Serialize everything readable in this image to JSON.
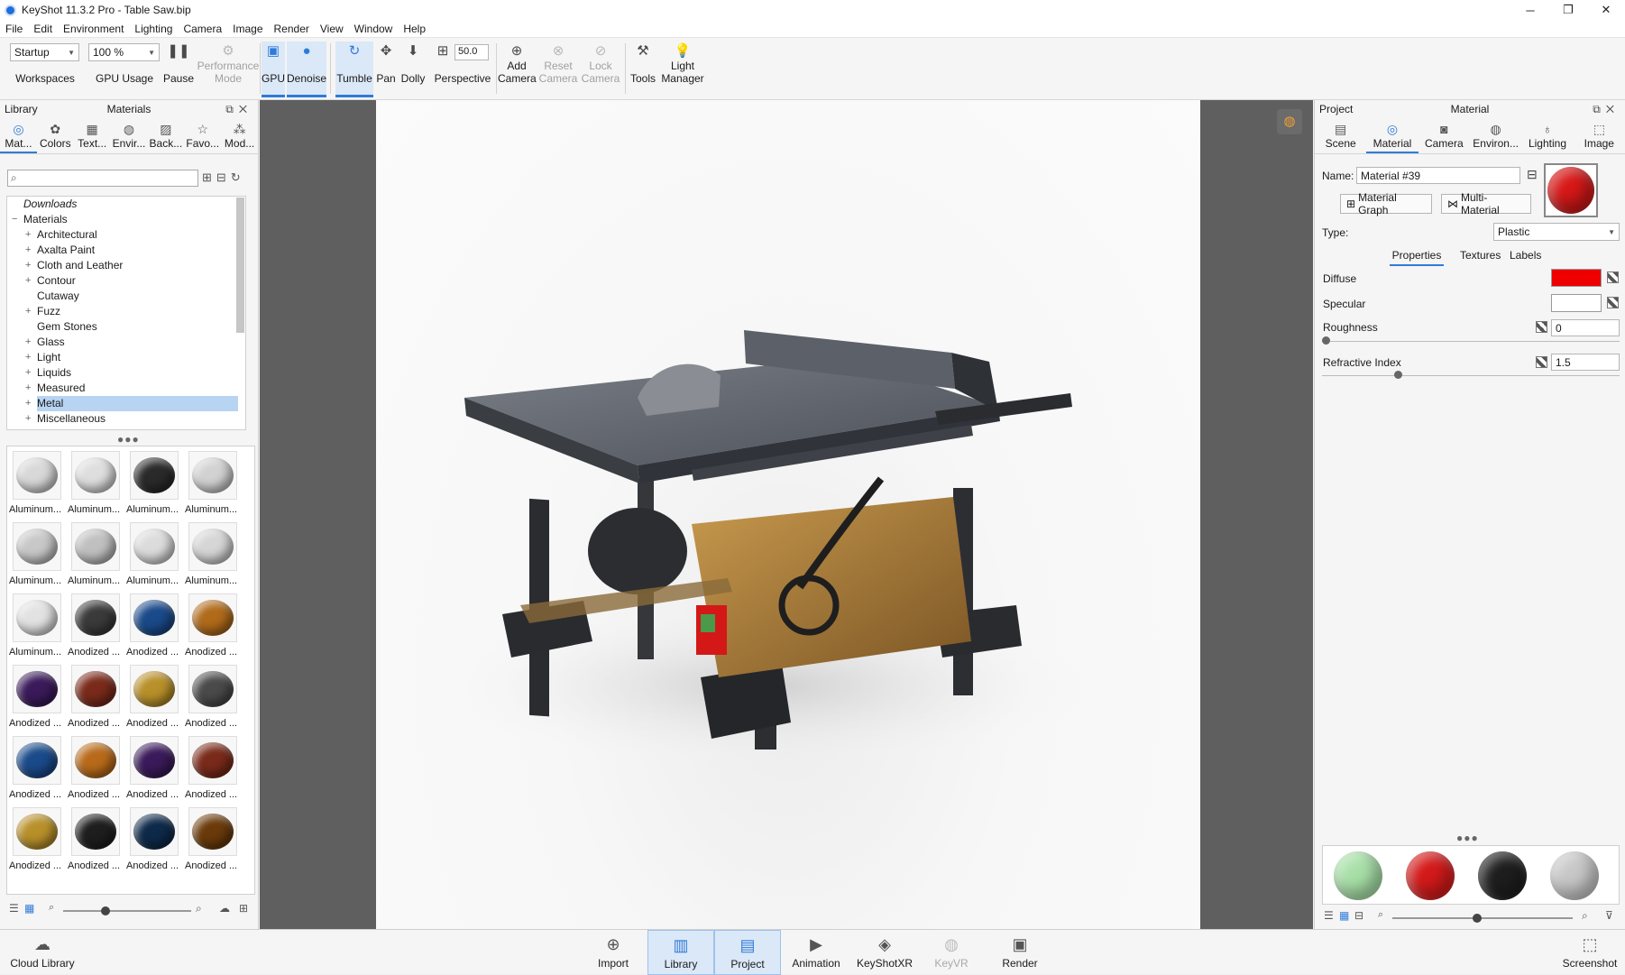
{
  "window": {
    "title": "KeyShot 11.3.2 Pro  - Table Saw.bip",
    "minimize": "─",
    "maximize": "❐",
    "close": "✕"
  },
  "menu": [
    "File",
    "Edit",
    "Environment",
    "Lighting",
    "Camera",
    "Image",
    "Render",
    "View",
    "Window",
    "Help"
  ],
  "toolbar": {
    "workspace_value": "Startup",
    "workspaces_label": "Workspaces",
    "gpu_usage_value": "100 %",
    "gpu_usage_label": "GPU Usage",
    "pause_label": "Pause",
    "performance_label": "Performance Mode",
    "gpu_label": "GPU",
    "denoise_label": "Denoise",
    "tumble_label": "Tumble",
    "pan_label": "Pan",
    "dolly_label": "Dolly",
    "fov_value": "50.0",
    "perspective_label": "Perspective",
    "add_camera_label": "Add Camera",
    "reset_camera_label": "Reset Camera",
    "lock_camera_label": "Lock Camera",
    "tools_label": "Tools",
    "light_manager_label": "Light Manager"
  },
  "library": {
    "header_left": "Library",
    "header_center": "Materials",
    "tabs": [
      "Mat...",
      "Colors",
      "Text...",
      "Envir...",
      "Back...",
      "Favo...",
      "Mod..."
    ],
    "tree": [
      {
        "label": "Downloads",
        "level": 0,
        "expander": ""
      },
      {
        "label": "Materials",
        "level": 0,
        "expander": "−"
      },
      {
        "label": "Architectural",
        "level": 1,
        "expander": "+"
      },
      {
        "label": "Axalta Paint",
        "level": 1,
        "expander": "+"
      },
      {
        "label": "Cloth and Leather",
        "level": 1,
        "expander": "+"
      },
      {
        "label": "Contour",
        "level": 1,
        "expander": "+"
      },
      {
        "label": "Cutaway",
        "level": 1,
        "expander": ""
      },
      {
        "label": "Fuzz",
        "level": 1,
        "expander": "+"
      },
      {
        "label": "Gem Stones",
        "level": 1,
        "expander": ""
      },
      {
        "label": "Glass",
        "level": 1,
        "expander": "+"
      },
      {
        "label": "Light",
        "level": 1,
        "expander": "+"
      },
      {
        "label": "Liquids",
        "level": 1,
        "expander": "+"
      },
      {
        "label": "Measured",
        "level": 1,
        "expander": "+"
      },
      {
        "label": "Metal",
        "level": 1,
        "expander": "+",
        "selected": true
      },
      {
        "label": "Miscellaneous",
        "level": 1,
        "expander": "+"
      }
    ],
    "materials": [
      {
        "label": "Aluminum...",
        "color": "#d8d8d8"
      },
      {
        "label": "Aluminum...",
        "color": "#dedede"
      },
      {
        "label": "Aluminum...",
        "color": "#2a2a2a"
      },
      {
        "label": "Aluminum...",
        "color": "#d2d2d2"
      },
      {
        "label": "Aluminum...",
        "color": "#c8c8c8"
      },
      {
        "label": "Aluminum...",
        "color": "#c0c0c0"
      },
      {
        "label": "Aluminum...",
        "color": "#dcdcdc"
      },
      {
        "label": "Aluminum...",
        "color": "#d6d6d6"
      },
      {
        "label": "Aluminum...",
        "color": "#e2e2e2"
      },
      {
        "label": "Anodized ...",
        "color": "#3a3a3a"
      },
      {
        "label": "Anodized ...",
        "color": "#1a4a8a"
      },
      {
        "label": "Anodized ...",
        "color": "#b06a1a"
      },
      {
        "label": "Anodized ...",
        "color": "#3a1a5a"
      },
      {
        "label": "Anodized ...",
        "color": "#7a2a1a"
      },
      {
        "label": "Anodized ...",
        "color": "#b8902a"
      },
      {
        "label": "Anodized ...",
        "color": "#4a4a4a"
      },
      {
        "label": "Anodized ...",
        "color": "#1a4a8a"
      },
      {
        "label": "Anodized ...",
        "color": "#b86a1a"
      },
      {
        "label": "Anodized ...",
        "color": "#3a1a5a"
      },
      {
        "label": "Anodized ...",
        "color": "#7a2a1a"
      },
      {
        "label": "Anodized ...",
        "color": "#b8902a"
      },
      {
        "label": "Anodized ...",
        "color": "#1e1e1e"
      },
      {
        "label": "Anodized ...",
        "color": "#0e2a4a"
      },
      {
        "label": "Anodized ...",
        "color": "#6a3a0a"
      }
    ]
  },
  "project": {
    "header_left": "Project",
    "header_center": "Material",
    "tabs": [
      "Scene",
      "Material",
      "Camera",
      "Environ...",
      "Lighting",
      "Image"
    ],
    "name_label": "Name:",
    "name_value": "Material #39",
    "material_graph_label": "Material Graph",
    "multi_material_label": "Multi-Material",
    "type_label": "Type:",
    "type_value": "Plastic",
    "subtabs": [
      "Properties",
      "Textures",
      "Labels"
    ],
    "diffuse_label": "Diffuse",
    "diffuse_color": "#ee0000",
    "specular_label": "Specular",
    "specular_color": "#ffffff",
    "roughness_label": "Roughness",
    "roughness_value": "0",
    "refractive_label": "Refractive Index",
    "refractive_value": "1.5",
    "preview_color": "#d81818",
    "palette": [
      "#a8e0a8",
      "#d41a1a",
      "#1e1e1e",
      "#c8c8c8"
    ]
  },
  "bottom": {
    "cloud_library": "Cloud Library",
    "import": "Import",
    "library": "Library",
    "project": "Project",
    "animation": "Animation",
    "keyshotxr": "KeyShotXR",
    "keyvr": "KeyVR",
    "render": "Render",
    "screenshot": "Screenshot"
  }
}
